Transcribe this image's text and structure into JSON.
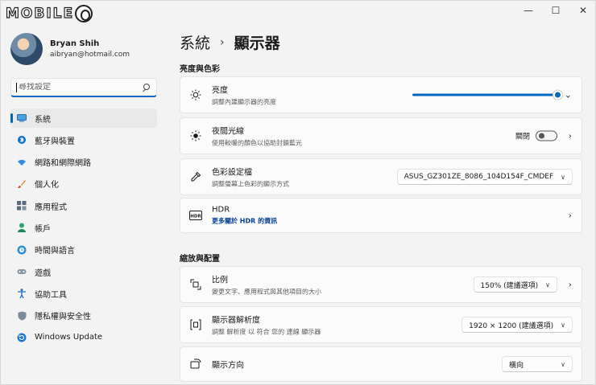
{
  "window": {
    "logo_text": "MOBILE",
    "controls": {
      "minimize": "—",
      "maximize": "☐",
      "close": "✕"
    }
  },
  "profile": {
    "name": "Bryan Shih",
    "email": "aibryan@hotmail.com"
  },
  "search": {
    "placeholder": "尋找設定"
  },
  "sidebar": {
    "items": [
      {
        "label": "系統",
        "icon": "monitor-icon",
        "active": true
      },
      {
        "label": "藍牙與裝置",
        "icon": "bluetooth-icon"
      },
      {
        "label": "網路和網際網路",
        "icon": "wifi-icon"
      },
      {
        "label": "個人化",
        "icon": "brush-icon"
      },
      {
        "label": "應用程式",
        "icon": "apps-icon"
      },
      {
        "label": "帳戶",
        "icon": "account-icon"
      },
      {
        "label": "時間與語言",
        "icon": "globe-clock-icon"
      },
      {
        "label": "遊戲",
        "icon": "gamepad-icon"
      },
      {
        "label": "協助工具",
        "icon": "accessibility-icon"
      },
      {
        "label": "隱私權與安全性",
        "icon": "shield-icon"
      },
      {
        "label": "Windows Update",
        "icon": "update-icon"
      }
    ]
  },
  "breadcrumb": {
    "parent": "系統",
    "separator": "›",
    "current": "顯示器"
  },
  "sections": {
    "brightness_color": "亮度與色彩",
    "scale_layout": "縮放與配置"
  },
  "cards": {
    "brightness": {
      "title": "亮度",
      "subtitle": "調整內建顯示器的亮度",
      "level_percent": 100
    },
    "night_light": {
      "title": "夜間光線",
      "subtitle": "使用較暖的顏色以協助封鎖藍光",
      "toggle_label": "關閉"
    },
    "color_profile": {
      "title": "色彩設定檔",
      "subtitle": "調整螢幕上色彩的顯示方式",
      "value": "ASUS_GZ301ZE_8086_104D154F_CMDEF"
    },
    "hdr": {
      "title": "HDR",
      "link": "更多關於 HDR 的資訊"
    },
    "scale": {
      "title": "比例",
      "subtitle": "變更文字、應用程式與其他項目的大小",
      "value": "150% (建議選項)"
    },
    "resolution": {
      "title": "顯示器解析度",
      "subtitle": "調整 解析度 以 符合 您的 連線 顯示器",
      "value": "1920 × 1200 (建議選項)"
    },
    "orientation": {
      "title": "顯示方向",
      "value": "橫向"
    }
  },
  "glyphs": {
    "chevron_right": "›",
    "chevron_down": "⌄",
    "dropdown_chevron": "∨"
  }
}
